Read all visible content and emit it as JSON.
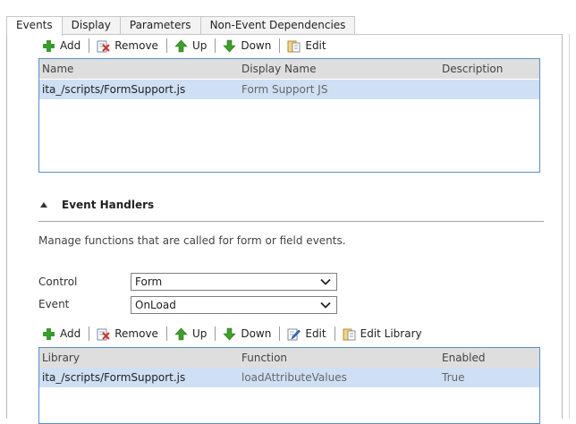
{
  "tabs": [
    {
      "label": "Events",
      "active": true
    },
    {
      "label": "Display",
      "active": false
    },
    {
      "label": "Parameters",
      "active": false
    },
    {
      "label": "Non-Event Dependencies",
      "active": false
    }
  ],
  "library_toolbar": {
    "add": "Add",
    "remove": "Remove",
    "up": "Up",
    "down": "Down",
    "edit": "Edit"
  },
  "library_grid": {
    "columns": [
      "Name",
      "Display Name",
      "Description"
    ],
    "rows": [
      {
        "name": "ita_/scripts/FormSupport.js",
        "display_name": "Form Support JS",
        "description": ""
      }
    ]
  },
  "event_handlers": {
    "title": "Event Handlers",
    "description": "Manage functions that are called for form or field events.",
    "control_label": "Control",
    "control_value": "Form",
    "event_label": "Event",
    "event_value": "OnLoad"
  },
  "handler_toolbar": {
    "add": "Add",
    "remove": "Remove",
    "up": "Up",
    "down": "Down",
    "edit": "Edit",
    "edit_library": "Edit Library"
  },
  "handler_grid": {
    "columns": [
      "Library",
      "Function",
      "Enabled"
    ],
    "rows": [
      {
        "library": "ita_/scripts/FormSupport.js",
        "function": "loadAttributeValues",
        "enabled": "True"
      }
    ]
  },
  "colors": {
    "grid_border": "#5b8ec9",
    "grid_header": "#dedede",
    "selected_row": "#cfe0f4",
    "add_icon": "#3a9b2e",
    "arrow_icon": "#3f9d2a",
    "remove_icon": "#d0342c"
  },
  "icons": {
    "add": "plus-icon",
    "remove": "remove-icon",
    "up": "arrow-up-icon",
    "down": "arrow-down-icon",
    "edit": "edit-icon",
    "edit_library": "library-icon",
    "dropdown": "chevron-down-icon",
    "collapse": "collapse-triangle-icon"
  }
}
